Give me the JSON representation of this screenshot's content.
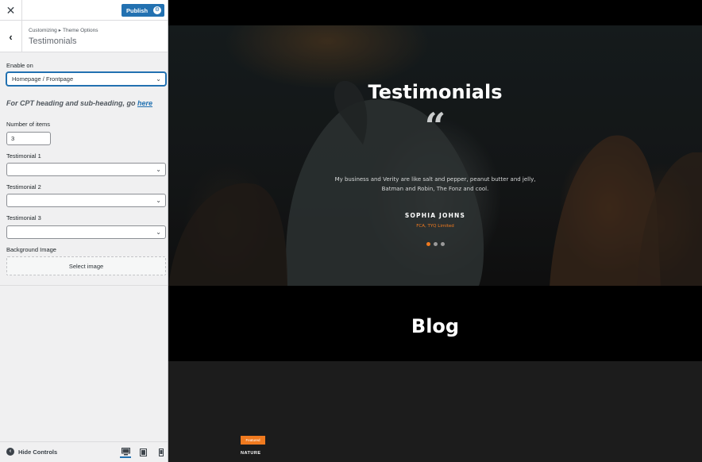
{
  "topbar": {
    "close_glyph": "✕",
    "publish_label": "Publish"
  },
  "section": {
    "breadcrumb_parent": "Customizing",
    "breadcrumb_separator": "▸",
    "breadcrumb_child": "Theme Options",
    "title": "Testimonials"
  },
  "controls": {
    "enable_on_label": "Enable on",
    "enable_on_value": "Homepage / Frontpage",
    "cpt_note_prefix": "For CPT heading and sub-heading, go",
    "cpt_note_link": "here",
    "number_of_items_label": "Number of items",
    "number_of_items_value": "3",
    "testimonial_1_label": "Testimonial 1",
    "testimonial_1_value": "",
    "testimonial_2_label": "Testimonial 2",
    "testimonial_2_value": "",
    "testimonial_3_label": "Testimonial 3",
    "testimonial_3_value": "",
    "background_image_label": "Background Image",
    "select_image_label": "Select image"
  },
  "footer": {
    "hide_controls_label": "Hide Controls"
  },
  "preview": {
    "hero_title": "Testimonials",
    "quote_glyph": "“",
    "quote_text": "My business and Verity are like salt and pepper, peanut butter and jelly, Batman and Robin, The Fonz and cool.",
    "author": "SOPHIA JOHNS",
    "company": "FCA, TYQ Limited",
    "slider_total": 3,
    "slider_active": 1,
    "blog_title": "Blog",
    "featured_badge": "Featured",
    "category": "NATURE"
  },
  "colors": {
    "accent": "#2271b1",
    "theme_orange": "#f07a1f",
    "sidebar_bg": "#f0f0f1"
  },
  "icons": [
    "close-icon",
    "gear-icon",
    "back-arrow-icon",
    "chevron-down-icon",
    "hide-controls-icon",
    "desktop-icon",
    "tablet-icon",
    "mobile-icon"
  ]
}
